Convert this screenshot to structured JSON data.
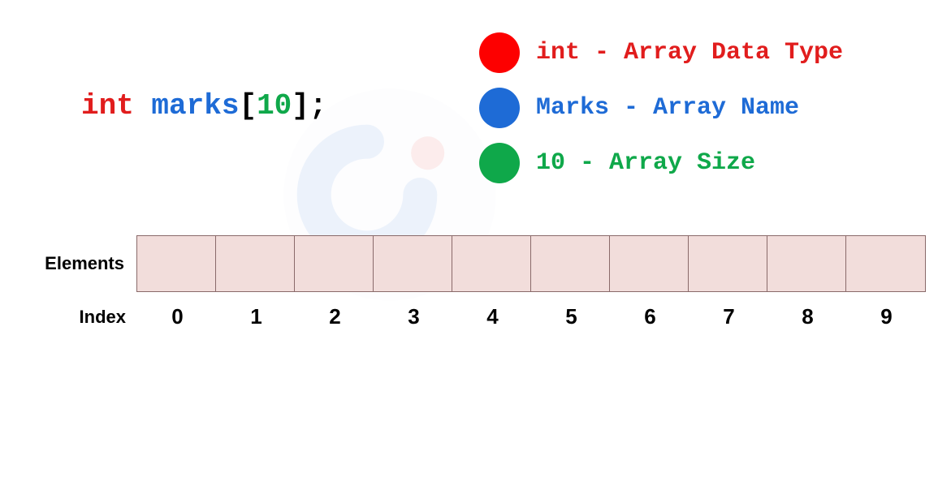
{
  "declaration": {
    "type_kw": "int",
    "name": "marks",
    "open_bracket": "[",
    "size": "10",
    "close_bracket": "]",
    "semicolon": ";"
  },
  "legend": {
    "type_label": "int - Array Data Type",
    "name_label": "Marks - Array Name",
    "size_label": "10 - Array Size"
  },
  "array": {
    "elements_label": "Elements",
    "index_label": "Index",
    "indices": [
      "0",
      "1",
      "2",
      "3",
      "4",
      "5",
      "6",
      "7",
      "8",
      "9"
    ]
  }
}
